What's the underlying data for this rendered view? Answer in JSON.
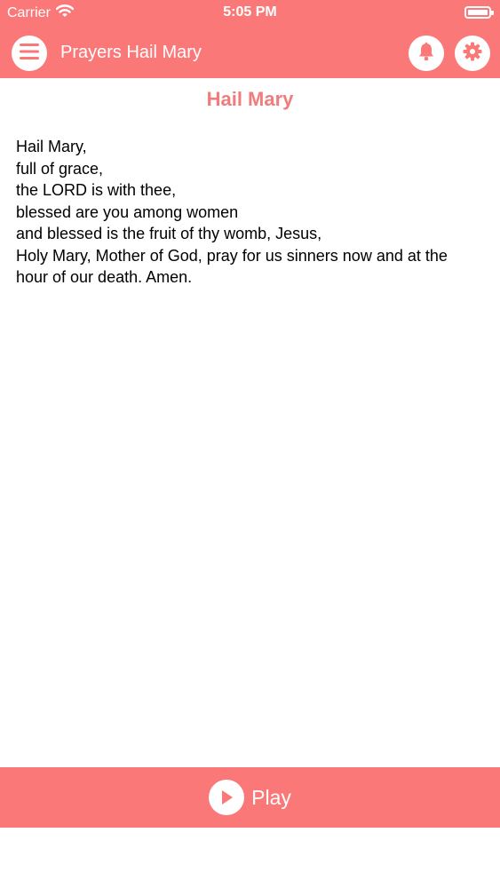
{
  "status_bar": {
    "carrier": "Carrier",
    "time": "5:05 PM"
  },
  "nav": {
    "title": "Prayers Hail Mary",
    "icons": [
      "menu-icon",
      "bell-icon",
      "gear-icon"
    ]
  },
  "prayer": {
    "title": "Hail Mary",
    "lines": [
      "Hail Mary,",
      "full of grace,",
      "the LORD is with thee,",
      "blessed are you among women",
      "and blessed is the fruit of thy womb, Jesus,",
      "Holy Mary, Mother of God, pray for us sinners now and at the",
      "hour of our death. Amen."
    ]
  },
  "player": {
    "play_label": "Play",
    "icon": "play-icon"
  },
  "colors": {
    "accent": "#fb7878",
    "title": "#f07c7c"
  }
}
